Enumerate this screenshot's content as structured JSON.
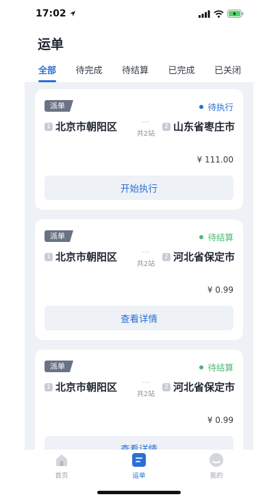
{
  "status_bar": {
    "time": "17:02"
  },
  "header": {
    "title": "运单"
  },
  "tabs": [
    {
      "label": "全部",
      "active": true
    },
    {
      "label": "待完成",
      "active": false
    },
    {
      "label": "待结算",
      "active": false
    },
    {
      "label": "已完成",
      "active": false
    },
    {
      "label": "已关闭",
      "active": false
    }
  ],
  "orders": [
    {
      "badge": "派单",
      "status": "待执行",
      "status_color": "#2a6fd6",
      "from_num": "1",
      "from": "北京市朝阳区",
      "to_num": "2",
      "to": "山东省枣庄市",
      "dots": "···",
      "stops": "共2站",
      "price": "¥ 111.00",
      "action": "开始执行"
    },
    {
      "badge": "派单",
      "status": "待结算",
      "status_color": "#4cb873",
      "from_num": "1",
      "from": "北京市朝阳区",
      "to_num": "2",
      "to": "河北省保定市",
      "dots": "···",
      "stops": "共2站",
      "price": "¥ 0.99",
      "action": "查看详情"
    },
    {
      "badge": "派单",
      "status": "待结算",
      "status_color": "#4cb873",
      "from_num": "1",
      "from": "北京市朝阳区",
      "to_num": "2",
      "to": "河北省保定市",
      "dots": "···",
      "stops": "共2站",
      "price": "¥ 0.99",
      "action": "查看详情"
    }
  ],
  "tabbar": [
    {
      "label": "首页",
      "icon": "home-icon",
      "active": false
    },
    {
      "label": "运单",
      "icon": "waybill-icon",
      "active": true
    },
    {
      "label": "我的",
      "icon": "profile-icon",
      "active": false
    }
  ],
  "colors": {
    "accent": "#2a6fd6",
    "background": "#eef1f5",
    "badge": "#6a7385"
  }
}
